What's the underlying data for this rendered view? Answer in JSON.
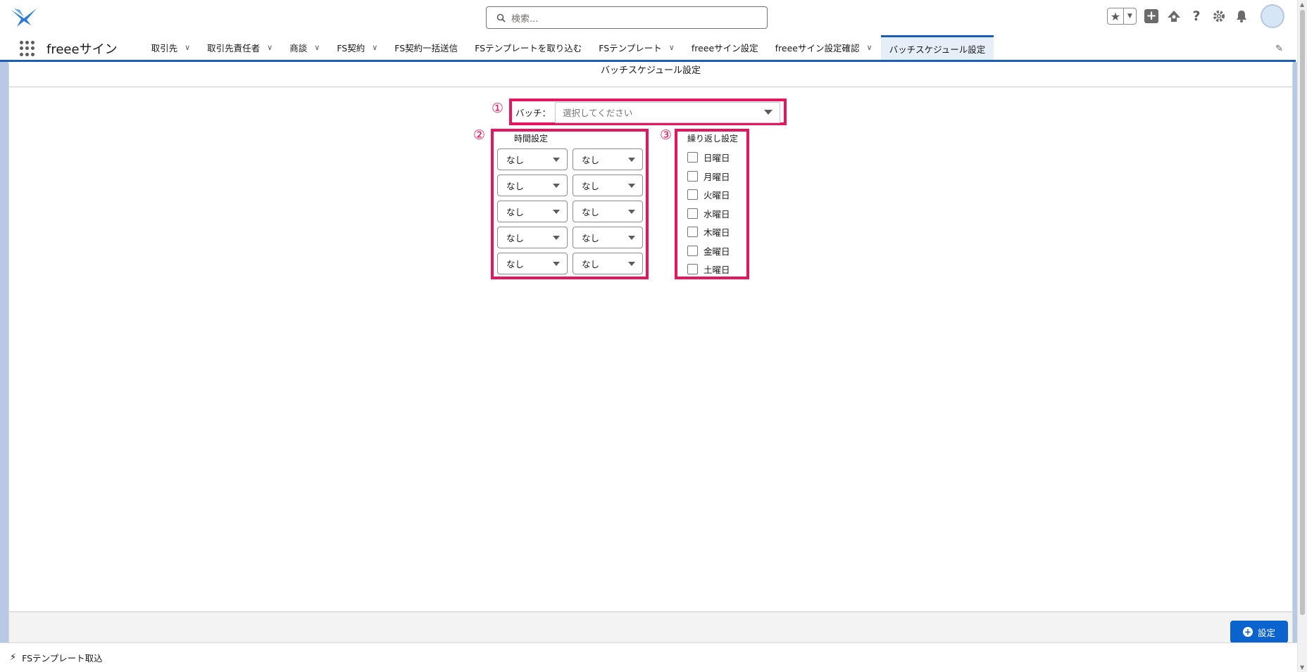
{
  "search": {
    "placeholder": "検索..."
  },
  "app": {
    "name": "freeeサイン"
  },
  "nav": {
    "items": [
      {
        "label": "取引先",
        "dropdown": true
      },
      {
        "label": "取引先責任者",
        "dropdown": true
      },
      {
        "label": "商談",
        "dropdown": true
      },
      {
        "label": "FS契約",
        "dropdown": true
      },
      {
        "label": "FS契約一括送信",
        "dropdown": false
      },
      {
        "label": "FSテンプレートを取り込む",
        "dropdown": false
      },
      {
        "label": "FSテンプレート",
        "dropdown": true
      },
      {
        "label": "freeeサイン設定",
        "dropdown": false
      },
      {
        "label": "freeeサイン設定確認",
        "dropdown": true
      },
      {
        "label": "バッチスケジュール設定",
        "dropdown": false,
        "active": true
      }
    ]
  },
  "page": {
    "title": "バッチスケジュール設定"
  },
  "annotations": {
    "one": "①",
    "two": "②",
    "three": "③"
  },
  "batch": {
    "label": "バッチ：",
    "placeholder": "選択してください"
  },
  "time_settings": {
    "title": "時間設定",
    "rows": [
      [
        "なし",
        "なし"
      ],
      [
        "なし",
        "なし"
      ],
      [
        "なし",
        "なし"
      ],
      [
        "なし",
        "なし"
      ],
      [
        "なし",
        "なし"
      ]
    ]
  },
  "repeat_settings": {
    "title": "繰り返し設定",
    "days": [
      {
        "label": "日曜日",
        "checked": false
      },
      {
        "label": "月曜日",
        "checked": false
      },
      {
        "label": "火曜日",
        "checked": false
      },
      {
        "label": "水曜日",
        "checked": false
      },
      {
        "label": "木曜日",
        "checked": false
      },
      {
        "label": "金曜日",
        "checked": false
      },
      {
        "label": "土曜日",
        "checked": false
      }
    ]
  },
  "footer": {
    "set_button": "設定"
  },
  "utility_bar": {
    "item": "FSテンプレート取込"
  },
  "colors": {
    "brand_blue": "#0b63ce",
    "annotation": "#e5165e",
    "nav_active": "#1b5fb4"
  }
}
